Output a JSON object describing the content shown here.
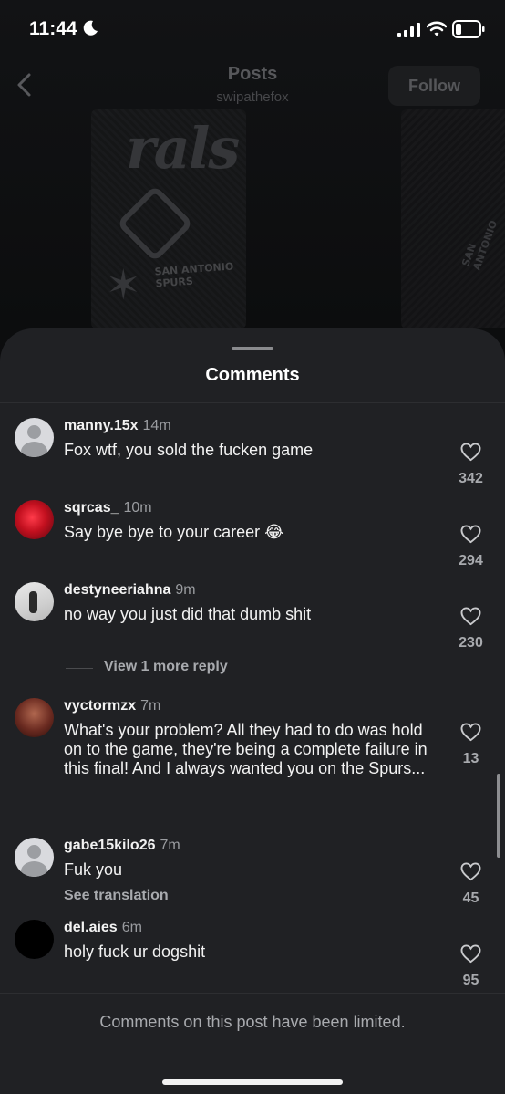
{
  "status_bar": {
    "time": "11:44",
    "icons": [
      "moon-icon",
      "signal-icon",
      "wifi-icon",
      "battery-icon"
    ]
  },
  "header": {
    "title": "Posts",
    "subtitle": "swipathefox",
    "follow_label": "Follow"
  },
  "post_image": {
    "jersey_left_script": "rals",
    "jersey_left_brand": "SAN ANTONIO SPURS",
    "jersey_right_brand": "SAN ANTONIO"
  },
  "sheet": {
    "title": "Comments"
  },
  "comments": [
    {
      "username": "manny.15x",
      "age": "14m",
      "text": "Fox wtf, you sold the fucken game",
      "likes": "342"
    },
    {
      "username": "sqrcas_",
      "age": "10m",
      "text": "Say bye bye to your career 😂",
      "likes": "294"
    },
    {
      "username": "destyneeriahna",
      "age": "9m",
      "text": "no way you just did that dumb shit",
      "likes": "230"
    },
    {
      "username": "vyctormzx",
      "age": "7m",
      "text": "What's your problem? All they had to do was hold on to the game, they're being a complete failure in this final! And I always wanted you on the Spurs...",
      "likes": "13"
    },
    {
      "username": "gabe15kilo26",
      "age": "7m",
      "text": "Fuk you",
      "likes": "45",
      "see_translation": "See translation"
    },
    {
      "username": "del.aies",
      "age": "6m",
      "text": "holy fuck ur dogshit",
      "likes": "95"
    }
  ],
  "view_more_replies": "View 1 more reply",
  "footer_note": "Comments on this post have been limited.",
  "colors": {
    "sheet_bg": "#202124",
    "text_primary": "#f2f2f2",
    "text_secondary": "#a8aaae"
  }
}
